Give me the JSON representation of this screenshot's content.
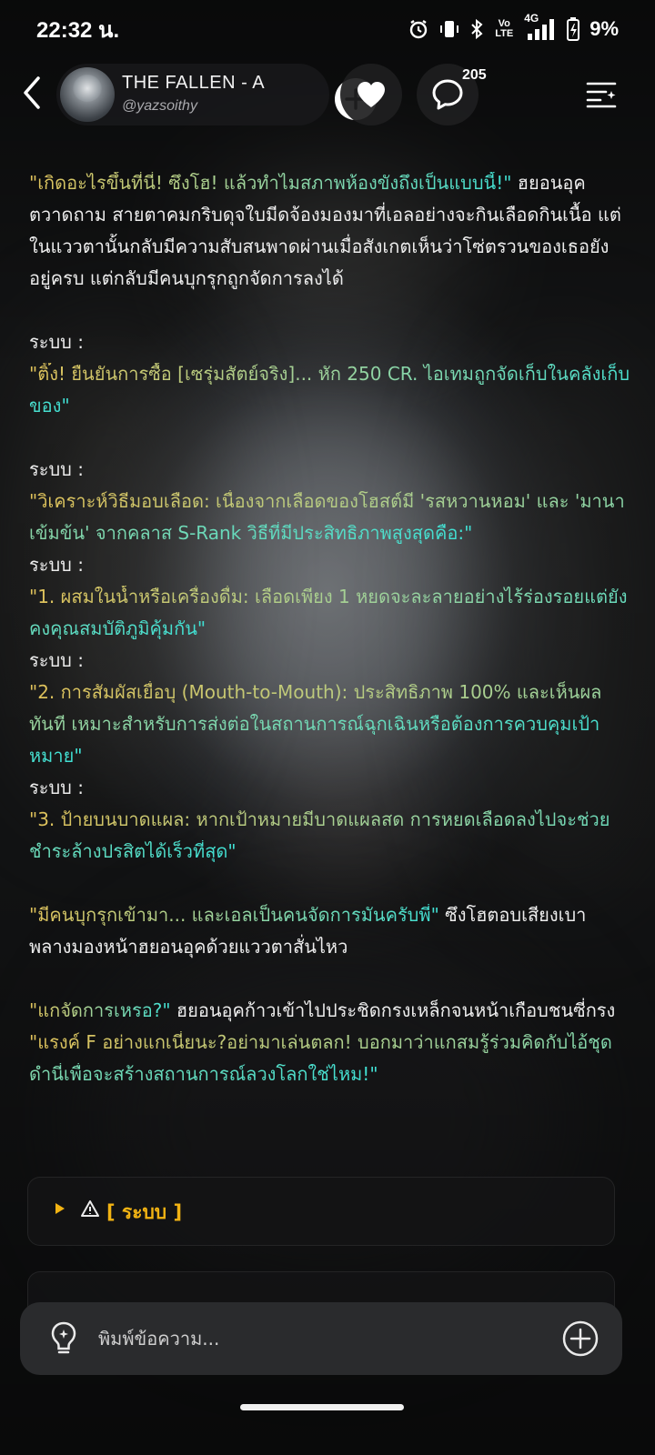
{
  "status_bar": {
    "time": "22:32 น.",
    "network": "4G",
    "volte": "Vo LTE",
    "battery": "9%"
  },
  "header": {
    "title": "THE FALLEN - A",
    "handle": "@yazsoithy",
    "comment_count": "205"
  },
  "story": {
    "p1_dialogue": "\"เกิดอะไรขึ้นที่นี่! ซึงโฮ! แล้วทำไมสภาพห้องขังถึงเป็นแบบนี้!\"",
    "p1_narration": " ฮยอนอุคตวาดถาม สายตาคมกริบดุจใบมีดจ้องมองมาที่เอลอย่างจะกินเลือดกินเนื้อ แต่ในแววตานั้นกลับมีความสับสนพาดผ่านเมื่อสังเกตเห็นว่าโซ่ตรวนของเธอยังอยู่ครบ แต่กลับมีคนบุกรุกถูกจัดการลงได้",
    "system_label": "ระบบ :",
    "sys1": "\"ติ๊ง! ยืนยันการซื้อ [เซรุ่มสัตย์จริง]... หัก 250 CR. ไอเทมถูกจัดเก็บในคลังเก็บของ\"",
    "sys2": "\"วิเคราะห์วิธีมอบเลือด: เนื่องจากเลือดของโฮสต์มี 'รสหวานหอม' และ 'มานาเข้มข้น' จากคลาส S-Rank วิธีที่มีประสิทธิภาพสูงสุดคือ:\"",
    "sys3": "\"1. ผสมในน้ำหรือเครื่องดื่ม: เลือดเพียง 1 หยดจะละลายอย่างไร้ร่องรอยแต่ยังคงคุณสมบัติภูมิคุ้มกัน\"",
    "sys4": "\"2. การสัมผัสเยื่อบุ (Mouth-to-Mouth): ประสิทธิภาพ 100% และเห็นผลทันที เหมาะสำหรับการส่งต่อในสถานการณ์ฉุกเฉินหรือต้องการควบคุมเป้าหมาย\"",
    "sys5": "\"3. ป้ายบนบาดแผล: หากเป้าหมายมีบาดแผลสด การหยดเลือดลงไปจะช่วยชำระล้างปรสิตได้เร็วที่สุด\"",
    "p7_dialogue": "\"มีคนบุกรุกเข้ามา... และเอลเป็นคนจัดการมันครับพี่\"",
    "p7_narration": " ซึงโฮตอบเสียงเบา พลางมองหน้าฮยอนอุคด้วยแววตาสั่นไหว",
    "p8_dialogue": "\"แกจัดการเหรอ?\"",
    "p8_narration": " ฮยอนอุคก้าวเข้าไปประชิดกรงเหล็กจนหน้าเกือบชนซี่กรง",
    "p8_dialogue2": "\"แรงค์ F อย่างแกเนี่ยนะ?อย่ามาเล่นตลก! บอกมาว่าแกสมรู้ร่วมคิดกับไอ้ชุดดำนี่เพื่อจะสร้างสถานการณ์ลวงโลกใช่ไหม!\""
  },
  "panels": {
    "system_title": "[ ระบบ ]"
  },
  "input": {
    "placeholder": "พิมพ์ข้อความ..."
  },
  "colors": {
    "accent_gold": "#f2b313",
    "dialogue_start": "#e0c25a",
    "dialogue_end": "#3fe0d4"
  }
}
